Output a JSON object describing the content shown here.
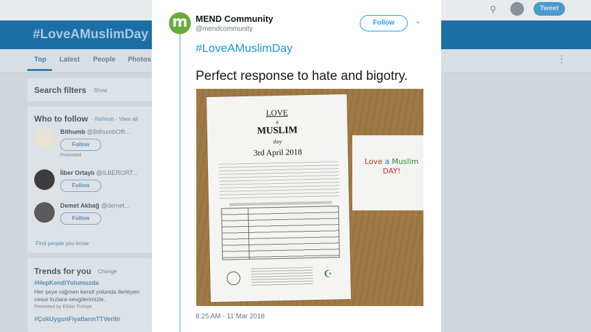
{
  "background": {
    "hero_title": "#LoveAMuslimDay",
    "tabs": [
      "Top",
      "Latest",
      "People",
      "Photos"
    ],
    "top_button": "Tweet",
    "search_filters": {
      "title": "Search filters",
      "show": "· Show"
    },
    "who_to_follow": {
      "title": "Who to follow",
      "links": "· Refresh · View all",
      "suggestions": [
        {
          "name": "Bithumb",
          "handle": "@BithumbOffi...",
          "follow": "Follow",
          "promoted": "Promoted"
        },
        {
          "name": "İlber Ortaylı",
          "handle": "@ILBERORT...",
          "follow": "Follow"
        },
        {
          "name": "Demet Akbağ",
          "handle": "@demet...",
          "follow": "Follow"
        }
      ],
      "find_people": "Find people you know"
    },
    "trends": {
      "title": "Trends for you",
      "change": "· Change",
      "items": [
        {
          "tag": "#HepKendiYolumuzda",
          "desc": "Her şeye rağmen kendi yolunda ilerleyen cesur kızlara sevgilerimizle.",
          "promoted": "Promoted by Elidor Türkiye"
        },
        {
          "tag": "#ÇokUygunFiyatlarınTTVerilir"
        }
      ]
    }
  },
  "tweet": {
    "author": "MEND Community",
    "handle": "@mendcommunity",
    "avatar_letter": "m",
    "follow": "Follow",
    "hashtag": "#LoveAMuslimDay",
    "text": "Perfect response to hate and bigotry.",
    "timestamp": "8:25 AM - 11 Mar 2018",
    "photo": {
      "letter_line1": "LOVE",
      "letter_line2": "a",
      "letter_line3": "MUSLIM",
      "letter_line4": "day",
      "letter_date": "3rd April 2018",
      "envelope_text": "Love a Muslim DAY!"
    }
  },
  "colors": {
    "accent": "#1da1f2",
    "brand_green": "#6aaa3d",
    "hero_blue": "#1b6fa6"
  }
}
